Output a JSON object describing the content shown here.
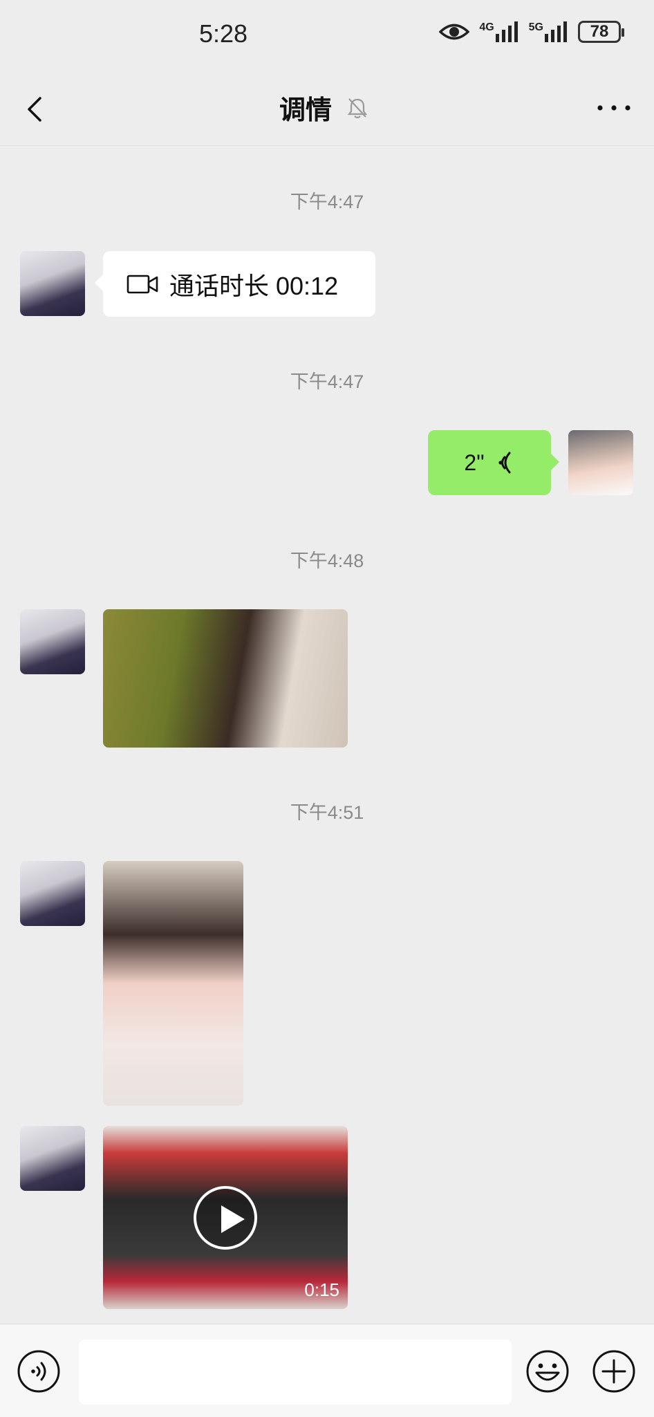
{
  "status_bar": {
    "time": "5:28",
    "network_1": "4G",
    "network_2": "5G",
    "battery": "78"
  },
  "nav": {
    "title": "调情",
    "back_icon": "chevron-left-icon",
    "mute_icon": "bell-off-icon",
    "more_icon": "more-horizontal-icon"
  },
  "messages": [
    {
      "type": "timestamp",
      "text": "下午4:47"
    },
    {
      "type": "call",
      "sender": "other",
      "icon": "video-camera-icon",
      "text": "通话时长 00:12"
    },
    {
      "type": "timestamp",
      "text": "下午4:47"
    },
    {
      "type": "voice",
      "sender": "self",
      "duration": "2\"",
      "icon": "voice-wave-icon"
    },
    {
      "type": "timestamp",
      "text": "下午4:48"
    },
    {
      "type": "image",
      "sender": "other"
    },
    {
      "type": "timestamp",
      "text": "下午4:51"
    },
    {
      "type": "image",
      "sender": "other"
    },
    {
      "type": "video",
      "sender": "other",
      "duration": "0:15"
    }
  ],
  "input_bar": {
    "placeholder": "",
    "voice_icon": "voice-toggle-icon",
    "emoji_icon": "emoji-icon",
    "plus_icon": "plus-circle-icon"
  },
  "colors": {
    "background": "#ededed",
    "bubble_self": "#95ec69",
    "bubble_other": "#ffffff",
    "timestamp": "#8a8a8a"
  }
}
